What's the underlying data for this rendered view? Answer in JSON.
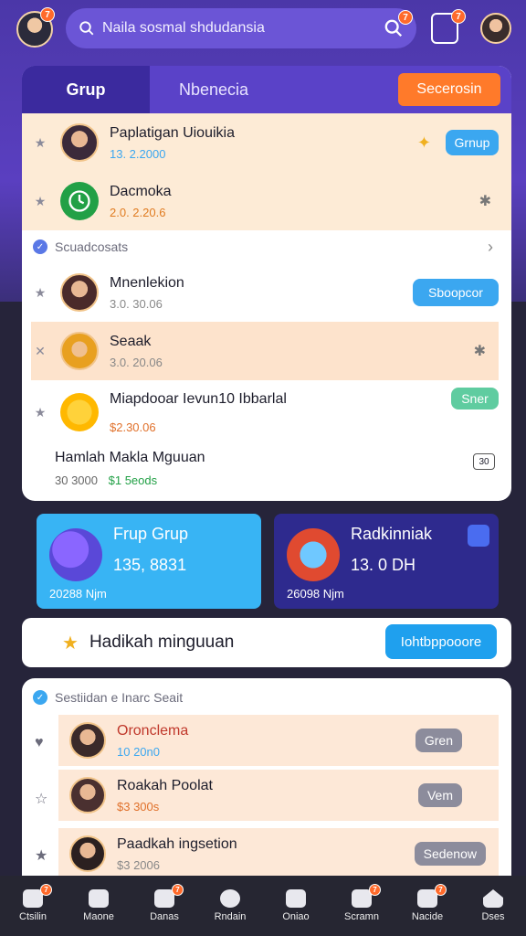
{
  "colors": {
    "primary": "#5a42c8",
    "accent": "#ff7a2a",
    "blue": "#3ba7f0",
    "green": "#22a046",
    "teal": "#5fcca0"
  },
  "topbar": {
    "search_placeholder": "Naila sosmal shdudansia",
    "avatar_badge": "7",
    "search_badge": "7",
    "notif_badge": "7"
  },
  "tabs": {
    "items": [
      {
        "label": "Grup"
      },
      {
        "label": "Nbenecia"
      }
    ],
    "cta_label": "Secerosin"
  },
  "top_rows": [
    {
      "name": "Paplatigan Uiouikia",
      "sub": "13. 2.2000",
      "pill": "Grnup"
    },
    {
      "name": "Dacmoka",
      "sub": "2.0. 2.20.6"
    }
  ],
  "section1": {
    "title": "Scuadcosats",
    "rows": [
      {
        "name": "Mnenlekion",
        "sub": "3.0. 30.06",
        "pill": "Sboopcor"
      },
      {
        "name": "Seaak",
        "sub": "3.0. 20.06"
      },
      {
        "name": "Miapdooar Ievun10 Ibbarlal",
        "sub": "$2.30.06",
        "pill": "Sner"
      }
    ],
    "footer": {
      "name": "Hamlah Makla Mguuan",
      "count_a": "30 3000",
      "count_b": "$1 5eods",
      "badge": "30"
    }
  },
  "stats": [
    {
      "title": "Frup Grup",
      "value": "135, 8831",
      "foot": "20288 Njm"
    },
    {
      "title": "Radkinniak",
      "value": "13. 0 DH",
      "foot": "26098 Njm"
    }
  ],
  "reward": {
    "label": "Hadikah minguuan",
    "button": "Iohtbppooore"
  },
  "section2": {
    "title": "Sestiidan e Inarc Seait",
    "rows": [
      {
        "name": "Oronclema",
        "sub": "10 20n0",
        "pill": "Gren"
      },
      {
        "name": "Roakah Poolat",
        "sub": "$3 300s",
        "pill": "Vem"
      },
      {
        "name": "Paadkah ingsetion",
        "sub": "$3 2006",
        "pill": "Sedenow"
      }
    ]
  },
  "nav": {
    "items": [
      {
        "label": "Ctsilin",
        "badge": "7"
      },
      {
        "label": "Maone",
        "badge": ""
      },
      {
        "label": "Danas",
        "badge": "7"
      },
      {
        "label": "Rndain",
        "badge": ""
      },
      {
        "label": "Oniao",
        "badge": ""
      },
      {
        "label": "Scramn",
        "badge": "7"
      },
      {
        "label": "Nacide",
        "badge": "7"
      },
      {
        "label": "Dses",
        "badge": ""
      }
    ]
  }
}
